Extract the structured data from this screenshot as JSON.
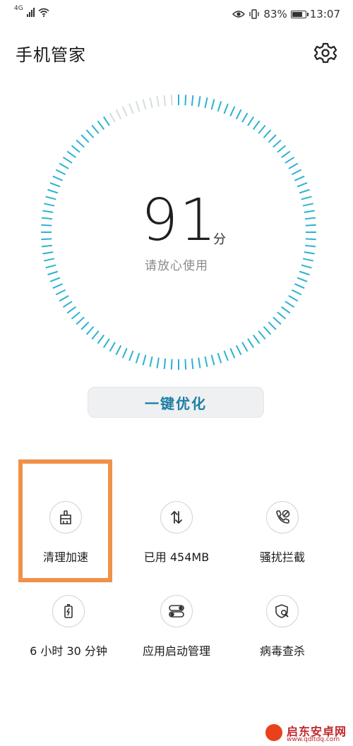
{
  "status_bar": {
    "network": "4G",
    "battery_text": "83%",
    "battery_level": 0.83,
    "time": "13:07"
  },
  "header": {
    "title": "手机管家"
  },
  "score": {
    "value": "91",
    "unit": "分",
    "subtitle": "请放心使用",
    "progress": 0.91
  },
  "optimize_button": {
    "label": "一键优化"
  },
  "tiles": [
    {
      "label": "清理加速",
      "icon": "broom-icon"
    },
    {
      "label": "已用 454MB",
      "icon": "data-traffic-icon"
    },
    {
      "label": "骚扰拦截",
      "icon": "call-block-icon"
    },
    {
      "label": "6 小时 30 分钟",
      "icon": "battery-icon"
    },
    {
      "label": "应用启动管理",
      "icon": "app-launch-icon"
    },
    {
      "label": "病毒查杀",
      "icon": "virus-scan-icon"
    }
  ],
  "watermark": {
    "name": "启东安卓网",
    "url": "www.qdltdq.com"
  },
  "colors": {
    "accent": "#1e7fa4",
    "gauge": "#2bb3d1",
    "gauge_faded": "#d5dde0",
    "highlight": "#f19149"
  }
}
